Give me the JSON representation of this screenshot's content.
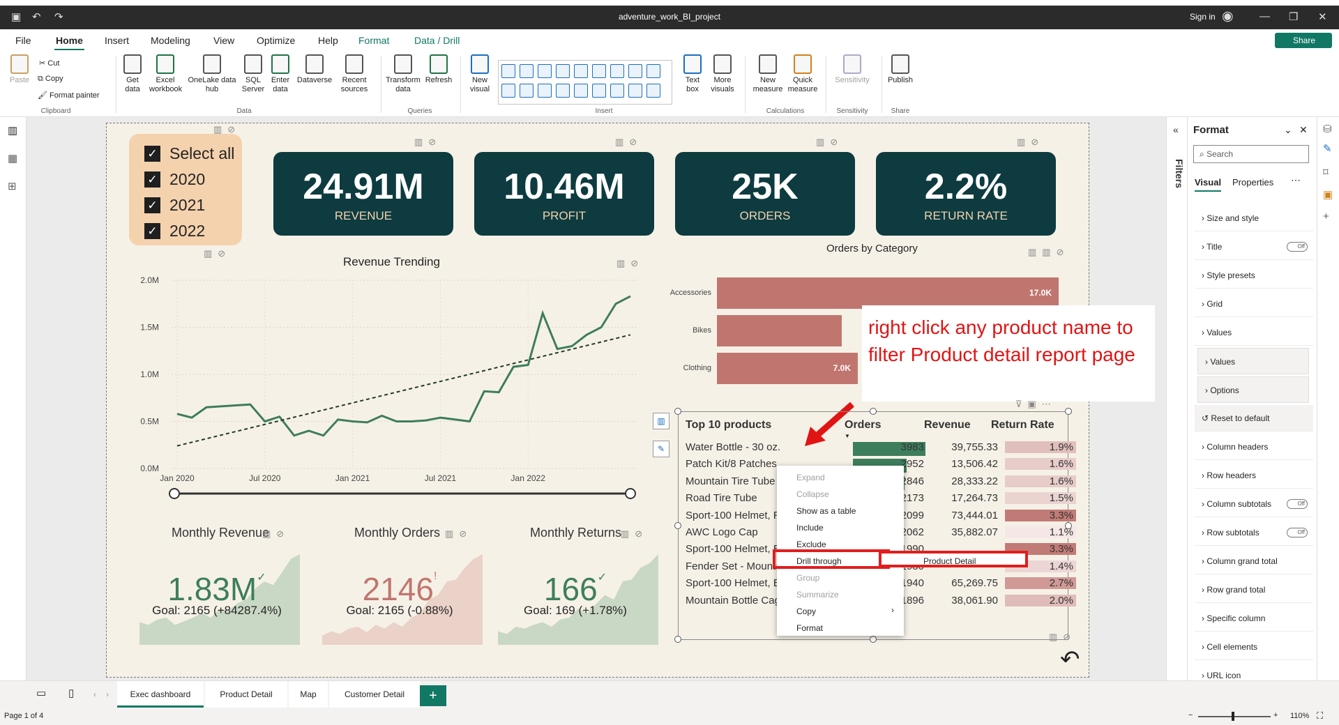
{
  "window": {
    "title": "adventure_work_BI_project",
    "signin": "Sign in"
  },
  "menu": {
    "tabs": [
      "File",
      "Home",
      "Insert",
      "Modeling",
      "View",
      "Optimize",
      "Help",
      "Format",
      "Data / Drill"
    ],
    "share": "Share"
  },
  "ribbon": {
    "paste": "Paste",
    "cut": "Cut",
    "copy": "Copy",
    "format_painter": "Format painter",
    "get_data": "Get data",
    "excel": "Excel workbook",
    "onelake": "OneLake data hub",
    "sql": "SQL Server",
    "enter_data": "Enter data",
    "dataverse": "Dataverse",
    "recent": "Recent sources",
    "transform": "Transform data",
    "refresh": "Refresh",
    "new_visual": "New visual",
    "text_box": "Text box",
    "more_visuals": "More visuals",
    "new_measure": "New measure",
    "quick_measure": "Quick measure",
    "sensitivity": "Sensitivity",
    "publish": "Publish",
    "groups": {
      "clipboard": "Clipboard",
      "data": "Data",
      "queries": "Queries",
      "insert": "Insert",
      "calculations": "Calculations",
      "sensitivity": "Sensitivity",
      "share": "Share"
    }
  },
  "slicer": {
    "items": [
      "Select all",
      "2020",
      "2021",
      "2022"
    ]
  },
  "kpis": [
    {
      "value": "24.91M",
      "label": "REVENUE"
    },
    {
      "value": "10.46M",
      "label": "PROFIT"
    },
    {
      "value": "25K",
      "label": "ORDERS"
    },
    {
      "value": "2.2%",
      "label": "RETURN RATE"
    }
  ],
  "chart_data": [
    {
      "type": "line",
      "title": "Revenue Trending",
      "x_ticks": [
        "Jan 2020",
        "Jul 2020",
        "Jan 2021",
        "Jul 2021",
        "Jan 2022"
      ],
      "y_ticks": [
        "0.0M",
        "0.5M",
        "1.0M",
        "1.5M",
        "2.0M"
      ],
      "ylim": [
        0,
        2.0
      ],
      "series": [
        {
          "values": [
            0.58,
            0.54,
            0.65,
            0.66,
            0.67,
            0.68,
            0.5,
            0.55,
            0.35,
            0.4,
            0.35,
            0.52,
            0.5,
            0.49,
            0.56,
            0.5,
            0.5,
            0.51,
            0.54,
            0.52,
            0.5,
            0.82,
            0.81,
            1.08,
            1.1,
            1.65,
            1.27,
            1.3,
            1.42,
            1.5,
            1.75,
            1.83
          ]
        },
        {
          "trend": true,
          "values": [
            0.24,
            1.42
          ]
        }
      ]
    },
    {
      "type": "bar",
      "title": "Orders by Category",
      "categories": [
        "Accessories",
        "Bikes",
        "Clothing"
      ],
      "values": [
        17.0,
        6.2,
        7.0
      ],
      "labels": [
        "17.0K",
        "",
        "7.0K"
      ]
    }
  ],
  "note": {
    "text": "right click any product name to filter Product detail report page"
  },
  "table": {
    "title": "Top 10 products",
    "columns": [
      "Orders",
      "Revenue",
      "Return Rate"
    ],
    "max_orders": 3983,
    "rows": [
      {
        "product": "Water Bottle - 30 oz.",
        "orders": "3983",
        "orders_val": 3983,
        "revenue": "39,755.33",
        "rr": "1.9%",
        "rr_val": 1.9
      },
      {
        "product": "Patch Kit/8 Patches",
        "orders": "2952",
        "orders_val": 2952,
        "revenue": "13,506.42",
        "rr": "1.6%",
        "rr_val": 1.6
      },
      {
        "product": "Mountain Tire Tube",
        "orders": "2846",
        "orders_val": 2846,
        "revenue": "28,333.22",
        "rr": "1.6%",
        "rr_val": 1.6
      },
      {
        "product": "Road Tire Tube",
        "orders": "2173",
        "orders_val": 2173,
        "revenue": "17,264.73",
        "rr": "1.5%",
        "rr_val": 1.5
      },
      {
        "product": "Sport-100 Helmet, Red",
        "orders": "2099",
        "orders_val": 2099,
        "revenue": "73,444.01",
        "rr": "3.3%",
        "rr_val": 3.3
      },
      {
        "product": "AWC Logo Cap",
        "orders": "2062",
        "orders_val": 2062,
        "revenue": "35,882.07",
        "rr": "1.1%",
        "rr_val": 1.1
      },
      {
        "product": "Sport-100 Helmet, Blue",
        "orders": "1990",
        "orders_val": 1990,
        "revenue": "",
        "rr": "3.3%",
        "rr_val": 3.3
      },
      {
        "product": "Fender Set - Mountain",
        "orders": "1980",
        "orders_val": 1980,
        "revenue": "",
        "rr": "1.4%",
        "rr_val": 1.4
      },
      {
        "product": "Sport-100 Helmet, Black",
        "orders": "1940",
        "orders_val": 1940,
        "revenue": "65,269.75",
        "rr": "2.7%",
        "rr_val": 2.7
      },
      {
        "product": "Mountain Bottle Cage",
        "orders": "1896",
        "orders_val": 1896,
        "revenue": "38,061.90",
        "rr": "2.0%",
        "rr_val": 2.0
      }
    ]
  },
  "context_menu": {
    "items": [
      {
        "label": "Expand",
        "disabled": true
      },
      {
        "label": "Collapse",
        "disabled": true
      },
      {
        "label": "Show as a table",
        "disabled": false
      },
      {
        "label": "Include",
        "disabled": false
      },
      {
        "label": "Exclude",
        "disabled": false
      },
      {
        "label": "Drill through",
        "disabled": false,
        "submenu": true
      },
      {
        "label": "Group",
        "disabled": true
      },
      {
        "label": "Summarize",
        "disabled": true
      },
      {
        "label": "Copy",
        "disabled": false,
        "submenu": true
      },
      {
        "label": "Format",
        "disabled": false
      }
    ],
    "submenu_item": "Product Detail"
  },
  "sparks": [
    {
      "title": "Monthly Revenue",
      "value": "1.83M",
      "mark": "✓",
      "goal": "Goal: 2165 (+84287.4%)",
      "color": "#3d7e5c",
      "fill": "#c9d8c5"
    },
    {
      "title": "Monthly Orders",
      "value": "2146",
      "mark": "!",
      "goal": "Goal: 2165 (-0.88%)",
      "color": "#c0766f",
      "fill": "#ead2c8"
    },
    {
      "title": "Monthly Returns",
      "value": "166",
      "mark": "✓",
      "goal": "Goal: 169 (+1.78%)",
      "color": "#3d7e5c",
      "fill": "#c9d8c5"
    }
  ],
  "format_pane": {
    "title": "Format",
    "search_placeholder": "Search",
    "tabs": [
      "Visual",
      "Properties"
    ],
    "sections": [
      "Size and style",
      "Title",
      "Style presets",
      "Grid",
      "Values",
      "Values",
      "Options",
      "Reset to default",
      "Column headers",
      "Row headers",
      "Column subtotals",
      "Row subtotals",
      "Column grand total",
      "Row grand total",
      "Specific column",
      "Cell elements",
      "URL icon"
    ],
    "toggle_off": "Off",
    "filters_label": "Filters"
  },
  "pages": [
    "Exec dashboard",
    "Product Detail",
    "Map",
    "Customer Detail"
  ],
  "status": {
    "page": "Page 1 of 4",
    "zoom": "110%"
  }
}
